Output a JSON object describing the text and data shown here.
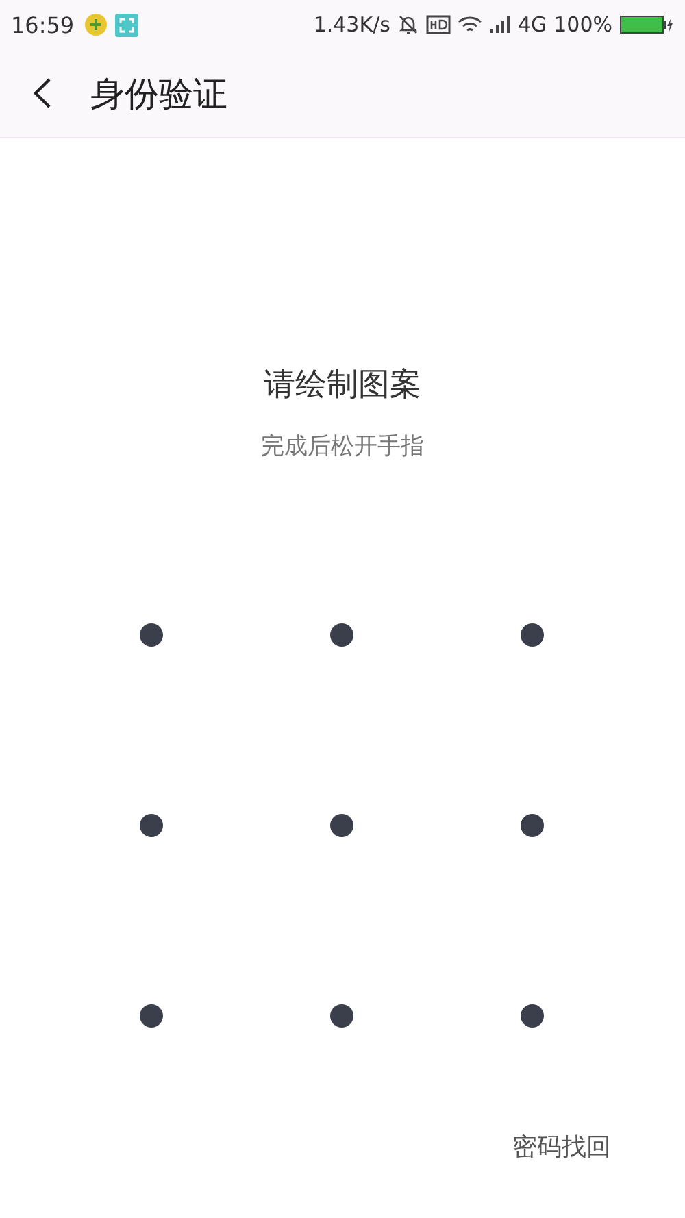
{
  "status_bar": {
    "time": "16:59",
    "network_speed": "1.43K/s",
    "network_type": "4G",
    "battery": "100%"
  },
  "header": {
    "title": "身份验证"
  },
  "prompt": {
    "title": "请绘制图案",
    "subtitle": "完成后松开手指"
  },
  "footer": {
    "link": "密码找回"
  }
}
